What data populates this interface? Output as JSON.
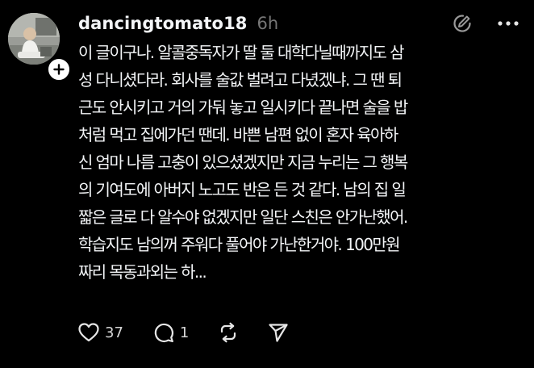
{
  "post": {
    "author": {
      "username": "dancingtomato18",
      "avatar_icon": "profile-photo"
    },
    "timestamp": "6h",
    "text_lines": [
      "이 글이구나. 알콜중독자가 딸 둘 대학다닐때까지도 삼",
      "성 다니셨다라. 회사를 술값 벌려고 다녔겠냐. 그 땐 퇴",
      "근도 안시키고 거의 가둬 놓고 일시키다 끝나면 술을 밥",
      "처럼 먹고 집에가던 땐데. 바쁜 남편 없이 혼자 육아하",
      "신 엄마 나름 고충이 있으셨겠지만 지금 누리는 그 행복",
      "의 기여도에 아버지 노고도 반은 든 것 같다. 남의 집 일",
      "짧은 글로 다 알수야 없겠지만 일단 스친은 안가난했어.",
      "학습지도 남의꺼 주워다 풀어야 가난한거야. 100만원",
      "짜리 목동과외는  하..."
    ],
    "stats": {
      "likes": "37",
      "replies": "1"
    }
  },
  "colors": {
    "background": "#000000",
    "text": "#f3f5f7",
    "muted": "#777777"
  },
  "icons": {
    "follow": "plus-icon",
    "header_1": "edit-circle-icon",
    "header_2": "more-icon",
    "like": "heart-icon",
    "reply": "comment-icon",
    "repost": "repost-icon",
    "share": "send-icon"
  }
}
